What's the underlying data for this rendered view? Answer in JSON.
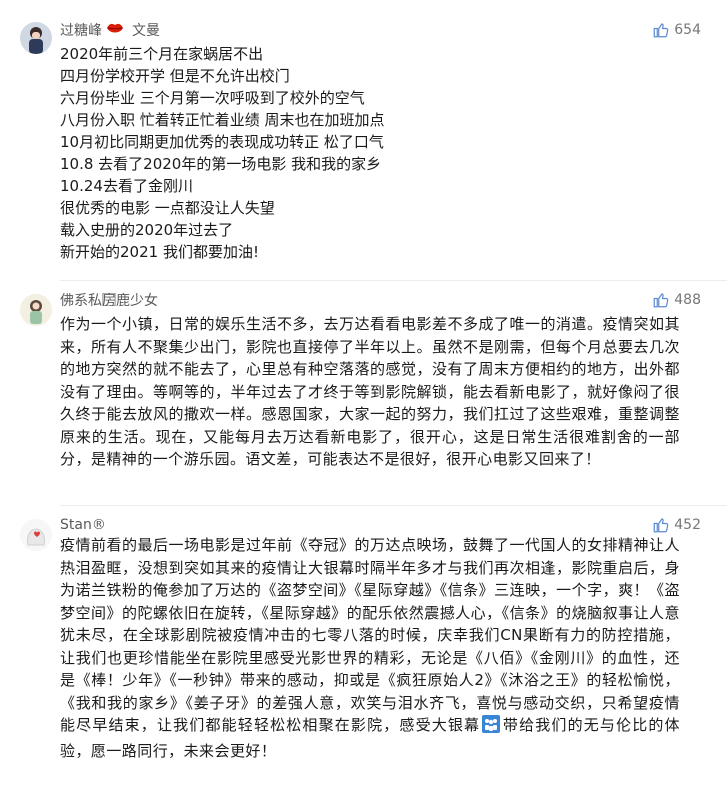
{
  "comments": [
    {
      "username": "过糖峰",
      "badge_icon": "lips-icon",
      "extra": "文曼",
      "likes": "654",
      "lines": [
        "2020年前三个月在家蜗居不出",
        "四月份学校开学 但是不允许出校门",
        "六月份毕业 三个月第一次呼吸到了校外的空气",
        "八月份入职 忙着转正忙着业绩 周末也在加班加点",
        "10月初比同期更加优秀的表现成功转正 松了口气",
        "10.8 去看了2020年的第一场电影 我和我的家乡",
        "10.24去看了金刚川",
        "很优秀的电影 一点都没让人失望",
        "载入史册的2020年过去了",
        "新开始的2021 我们都要加油!"
      ]
    },
    {
      "username": "佛系私房⃞⃞鹿少女",
      "likes": "488",
      "text": "作为一个小镇，日常的娱乐生活不多，去万达看看电影差不多成了唯一的消遣。疫情突如其来，所有人不聚集少出门，影院也直接停了半年以上。虽然不是刚需，但每个月总要去几次的地方突然的就不能去了，心里总有种空落落的感觉，没有了周末方便相约的地方，出外都没有了理由。等啊等的，半年过去了才终于等到影院解锁，能去看新电影了，就好像闷了很久终于能去放风的撒欢一样。感恩国家，大家一起的努力，我们扛过了这些艰难，重整调整原来的生活。现在，又能每月去万达看新电影了，很开心，这是日常生活很难割舍的一部分，是精神的一个游乐园。语文差，可能表达不是很好，很开心电影又回来了！"
    },
    {
      "username": "Stan®",
      "likes": "452",
      "text": "疫情前看的最后一场电影是过年前《夺冠》的万达点映场，鼓舞了一代国人的女排精神让人热泪盈眶，没想到突如其来的疫情让大银幕时隔半年多才与我们再次相逢，影院重启后，身为诺兰铁粉的俺参加了万达的《盗梦空间》《星际穿越》《信条》三连映，一个字，爽！《盗梦空间》的陀螺依旧在旋转，《星际穿越》的配乐依然震撼人心，《信条》的烧脑叙事让人意犹未尽，在全球影剧院被疫情冲击的七零八落的时候，庆幸我们CN果断有力的防控措施，让我们也更珍惜能坐在影院里感受光影世界的精彩，无论是《八佰》《金刚川》的血性，还是《棒！少年》《一秒钟》带来的感动，抑或是《疯狂原始人2》《沐浴之王》的轻松愉悦，《我和我的家乡》《姜子牙》的差强人意，欢笑与泪水齐飞，喜悦与感动交织，只希望疫情能尽早结束，让我们都能轻轻松松相聚在影院，感受大银幕",
      "emoji_icon": "crowd-emoji-icon",
      "text_tail": "带给我们的无与伦比的体验，愿一路同行，未来会更好！"
    }
  ]
}
